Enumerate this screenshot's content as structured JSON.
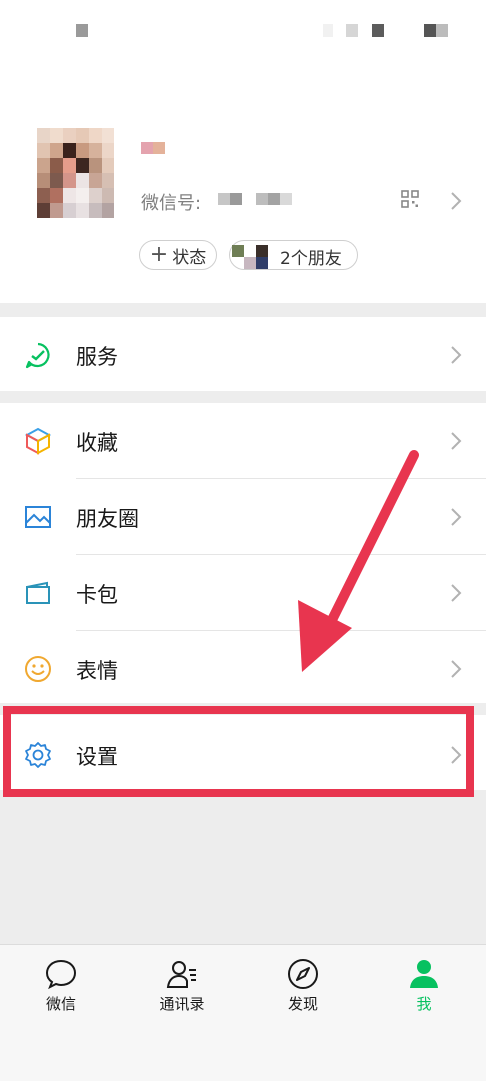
{
  "profile": {
    "wechat_id_label": "微信号:",
    "status_button": "状态",
    "friends_text": "2个朋友"
  },
  "menu": {
    "services": "服务",
    "favorites": "收藏",
    "moments": "朋友圈",
    "cards": "卡包",
    "stickers": "表情",
    "settings": "设置"
  },
  "tabs": [
    {
      "label": "微信",
      "icon": "chat-bubble-icon"
    },
    {
      "label": "通讯录",
      "icon": "contacts-icon"
    },
    {
      "label": "发现",
      "icon": "compass-icon"
    },
    {
      "label": "我",
      "icon": "person-icon"
    }
  ],
  "colors": {
    "accent_green": "#07c160",
    "annotation_red": "#e8354f"
  }
}
